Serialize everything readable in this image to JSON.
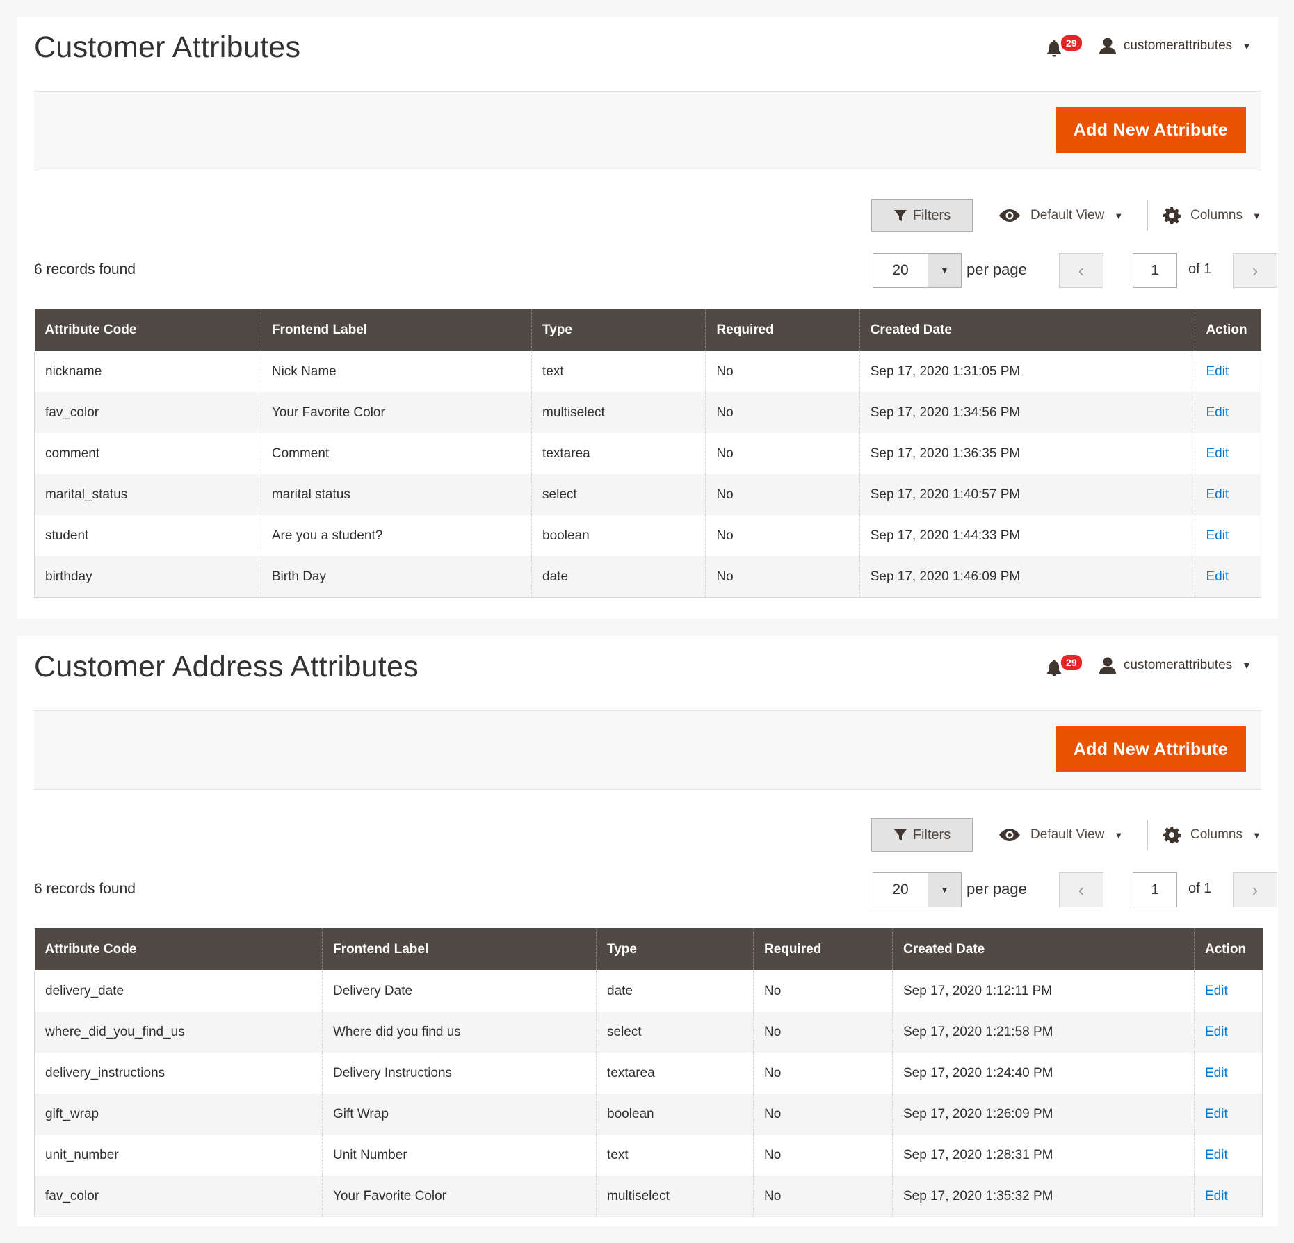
{
  "panels": [
    {
      "title": "Customer Attributes",
      "notifications_count": "29",
      "user": "customerattributes",
      "add_button": "Add New Attribute",
      "filters_label": "Filters",
      "view_label": "Default View",
      "columns_label": "Columns",
      "records_found": "6 records found",
      "per_page_value": "20",
      "per_page_label": "per page",
      "page_value": "1",
      "page_of": "of 1",
      "headers": [
        "Attribute Code",
        "Frontend Label",
        "Type",
        "Required",
        "Created Date",
        "Action"
      ],
      "rows": [
        [
          "nickname",
          "Nick Name",
          "text",
          "No",
          "Sep 17, 2020 1:31:05 PM",
          "Edit"
        ],
        [
          "fav_color",
          "Your Favorite Color",
          "multiselect",
          "No",
          "Sep 17, 2020 1:34:56 PM",
          "Edit"
        ],
        [
          "comment",
          "Comment",
          "textarea",
          "No",
          "Sep 17, 2020 1:36:35 PM",
          "Edit"
        ],
        [
          "marital_status",
          "marital status",
          "select",
          "No",
          "Sep 17, 2020 1:40:57 PM",
          "Edit"
        ],
        [
          "student",
          "Are you a student?",
          "boolean",
          "No",
          "Sep 17, 2020 1:44:33 PM",
          "Edit"
        ],
        [
          "birthday",
          "Birth Day",
          "date",
          "No",
          "Sep 17, 2020 1:46:09 PM",
          "Edit"
        ]
      ]
    },
    {
      "title": "Customer Address Attributes",
      "notifications_count": "29",
      "user": "customerattributes",
      "add_button": "Add New Attribute",
      "filters_label": "Filters",
      "view_label": "Default View",
      "columns_label": "Columns",
      "records_found": "6 records found",
      "per_page_value": "20",
      "per_page_label": "per page",
      "page_value": "1",
      "page_of": "of 1",
      "headers": [
        "Attribute Code",
        "Frontend Label",
        "Type",
        "Required",
        "Created Date",
        "Action"
      ],
      "rows": [
        [
          "delivery_date",
          "Delivery Date",
          "date",
          "No",
          "Sep 17, 2020 1:12:11 PM",
          "Edit"
        ],
        [
          "where_did_you_find_us",
          "Where did you find us",
          "select",
          "No",
          "Sep 17, 2020 1:21:58 PM",
          "Edit"
        ],
        [
          "delivery_instructions",
          "Delivery Instructions",
          "textarea",
          "No",
          "Sep 17, 2020 1:24:40 PM",
          "Edit"
        ],
        [
          "gift_wrap",
          "Gift Wrap",
          "boolean",
          "No",
          "Sep 17, 2020 1:26:09 PM",
          "Edit"
        ],
        [
          "unit_number",
          "Unit Number",
          "text",
          "No",
          "Sep 17, 2020 1:28:31 PM",
          "Edit"
        ],
        [
          "fav_color",
          "Your Favorite Color",
          "multiselect",
          "No",
          "Sep 17, 2020 1:35:32 PM",
          "Edit"
        ]
      ]
    }
  ],
  "icons": {
    "notifications": "bell-icon",
    "user": "user-icon",
    "filter": "filter-icon",
    "view": "eye-icon",
    "columns": "gear-icon",
    "prev": "chevron-left-icon",
    "next": "chevron-right-icon",
    "dropdown": "caret-down-icon"
  },
  "colors": {
    "accent": "#eb5202",
    "header_bg": "#514943",
    "link": "#007bdb",
    "badge": "#e22626"
  }
}
